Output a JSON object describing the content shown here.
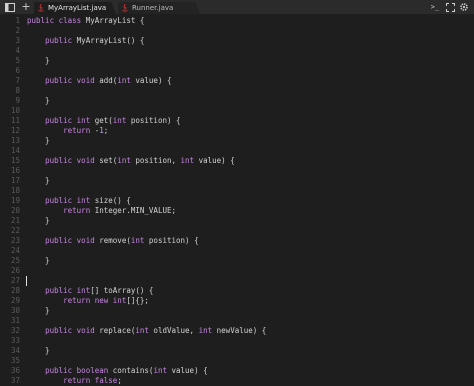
{
  "toolbar": {
    "sidebar_toggle_icon": "sidebar-toggle-icon",
    "new_tab_label": "+",
    "terminal_label": ">_",
    "fullscreen_label": "⛶",
    "settings_label": "⚙"
  },
  "tabs": [
    {
      "label": "MyArrayList.java",
      "active": true
    },
    {
      "label": "Runner.java",
      "active": false
    }
  ],
  "colors": {
    "background": "#1e1e1e",
    "tabbar": "#2b2b2b",
    "keyword": "#c586e0",
    "text": "#d4d4d4",
    "line_number": "#5a5a5a",
    "java_icon": "#d02a2a"
  },
  "editor": {
    "cursor_line": 27,
    "lines": [
      {
        "n": "1",
        "tokens": [
          [
            "kw",
            "public"
          ],
          [
            "t",
            " "
          ],
          [
            "kw",
            "class"
          ],
          [
            "t",
            " MyArrayList {"
          ]
        ]
      },
      {
        "n": "2",
        "tokens": []
      },
      {
        "n": "3",
        "tokens": [
          [
            "t",
            "    "
          ],
          [
            "kw",
            "public"
          ],
          [
            "t",
            " MyArrayList() {"
          ]
        ]
      },
      {
        "n": "4",
        "tokens": []
      },
      {
        "n": "5",
        "tokens": [
          [
            "t",
            "    }"
          ]
        ]
      },
      {
        "n": "6",
        "tokens": []
      },
      {
        "n": "7",
        "tokens": [
          [
            "t",
            "    "
          ],
          [
            "kw",
            "public"
          ],
          [
            "t",
            " "
          ],
          [
            "kw",
            "void"
          ],
          [
            "t",
            " add("
          ],
          [
            "kw",
            "int"
          ],
          [
            "t",
            " value) {"
          ]
        ]
      },
      {
        "n": "8",
        "tokens": []
      },
      {
        "n": "9",
        "tokens": [
          [
            "t",
            "    }"
          ]
        ]
      },
      {
        "n": "10",
        "tokens": []
      },
      {
        "n": "11",
        "tokens": [
          [
            "t",
            "    "
          ],
          [
            "kw",
            "public"
          ],
          [
            "t",
            " "
          ],
          [
            "kw",
            "int"
          ],
          [
            "t",
            " get("
          ],
          [
            "kw",
            "int"
          ],
          [
            "t",
            " position) {"
          ]
        ]
      },
      {
        "n": "12",
        "tokens": [
          [
            "t",
            "        "
          ],
          [
            "kw",
            "return"
          ],
          [
            "t",
            " -"
          ],
          [
            "nm",
            "1"
          ],
          [
            "t",
            ";"
          ]
        ]
      },
      {
        "n": "13",
        "tokens": [
          [
            "t",
            "    }"
          ]
        ]
      },
      {
        "n": "14",
        "tokens": []
      },
      {
        "n": "15",
        "tokens": [
          [
            "t",
            "    "
          ],
          [
            "kw",
            "public"
          ],
          [
            "t",
            " "
          ],
          [
            "kw",
            "void"
          ],
          [
            "t",
            " set("
          ],
          [
            "kw",
            "int"
          ],
          [
            "t",
            " position, "
          ],
          [
            "kw",
            "int"
          ],
          [
            "t",
            " value) {"
          ]
        ]
      },
      {
        "n": "16",
        "tokens": []
      },
      {
        "n": "17",
        "tokens": [
          [
            "t",
            "    }"
          ]
        ]
      },
      {
        "n": "18",
        "tokens": []
      },
      {
        "n": "19",
        "tokens": [
          [
            "t",
            "    "
          ],
          [
            "kw",
            "public"
          ],
          [
            "t",
            " "
          ],
          [
            "kw",
            "int"
          ],
          [
            "t",
            " size() {"
          ]
        ]
      },
      {
        "n": "20",
        "tokens": [
          [
            "t",
            "        "
          ],
          [
            "kw",
            "return"
          ],
          [
            "t",
            " Integer.MIN_VALUE;"
          ]
        ]
      },
      {
        "n": "21",
        "tokens": [
          [
            "t",
            "    }"
          ]
        ]
      },
      {
        "n": "22",
        "tokens": []
      },
      {
        "n": "23",
        "tokens": [
          [
            "t",
            "    "
          ],
          [
            "kw",
            "public"
          ],
          [
            "t",
            " "
          ],
          [
            "kw",
            "void"
          ],
          [
            "t",
            " remove("
          ],
          [
            "kw",
            "int"
          ],
          [
            "t",
            " position) {"
          ]
        ]
      },
      {
        "n": "24",
        "tokens": []
      },
      {
        "n": "25",
        "tokens": [
          [
            "t",
            "    }"
          ]
        ]
      },
      {
        "n": "26",
        "tokens": []
      },
      {
        "n": "27",
        "tokens": []
      },
      {
        "n": "28",
        "tokens": [
          [
            "t",
            "    "
          ],
          [
            "kw",
            "public"
          ],
          [
            "t",
            " "
          ],
          [
            "kw",
            "int"
          ],
          [
            "t",
            "[] toArray() {"
          ]
        ]
      },
      {
        "n": "29",
        "tokens": [
          [
            "t",
            "        "
          ],
          [
            "kw",
            "return"
          ],
          [
            "t",
            " "
          ],
          [
            "kw",
            "new"
          ],
          [
            "t",
            " "
          ],
          [
            "kw",
            "int"
          ],
          [
            "t",
            "[]{};"
          ]
        ]
      },
      {
        "n": "30",
        "tokens": [
          [
            "t",
            "    }"
          ]
        ]
      },
      {
        "n": "31",
        "tokens": []
      },
      {
        "n": "32",
        "tokens": [
          [
            "t",
            "    "
          ],
          [
            "kw",
            "public"
          ],
          [
            "t",
            " "
          ],
          [
            "kw",
            "void"
          ],
          [
            "t",
            " replace("
          ],
          [
            "kw",
            "int"
          ],
          [
            "t",
            " oldValue, "
          ],
          [
            "kw",
            "int"
          ],
          [
            "t",
            " newValue) {"
          ]
        ]
      },
      {
        "n": "33",
        "tokens": []
      },
      {
        "n": "34",
        "tokens": [
          [
            "t",
            "    }"
          ]
        ]
      },
      {
        "n": "35",
        "tokens": []
      },
      {
        "n": "36",
        "tokens": [
          [
            "t",
            "    "
          ],
          [
            "kw",
            "public"
          ],
          [
            "t",
            " "
          ],
          [
            "kw",
            "boolean"
          ],
          [
            "t",
            " contains("
          ],
          [
            "kw",
            "int"
          ],
          [
            "t",
            " value) {"
          ]
        ]
      },
      {
        "n": "37",
        "tokens": [
          [
            "t",
            "        "
          ],
          [
            "kw",
            "return"
          ],
          [
            "t",
            " "
          ],
          [
            "kw",
            "false"
          ],
          [
            "t",
            ";"
          ]
        ]
      }
    ]
  }
}
